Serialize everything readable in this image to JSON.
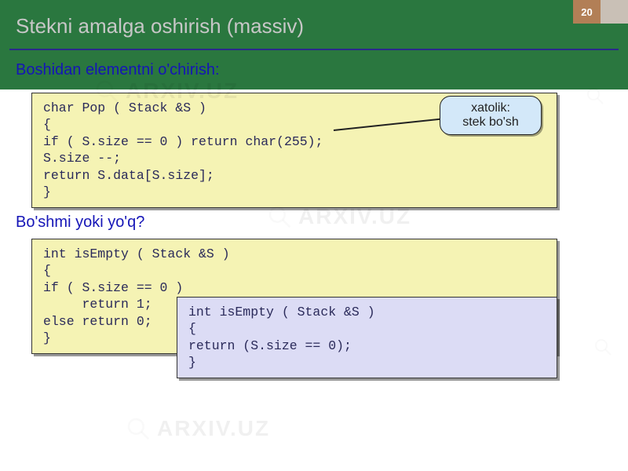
{
  "page_number": "20",
  "slide_title": "Stekni amalga oshirish (massiv)",
  "section1_heading": "Boshidan elementni o'chirish:",
  "code1": "char Pop ( Stack &S )\n{\nif ( S.size == 0 ) return char(255);\nS.size --;\nreturn S.data[S.size];\n}",
  "callout_line1": "xatolik:",
  "callout_line2": "stek bo'sh",
  "section2_heading": "Bo'shmi yoki yo'q?",
  "code2": "int isEmpty ( Stack &S )\n{\nif ( S.size == 0 )\n     return 1;\nelse return 0;\n}",
  "code3": "int isEmpty ( Stack &S )\n{\nreturn (S.size == 0);\n}",
  "watermark_text": "ARXIV.UZ"
}
